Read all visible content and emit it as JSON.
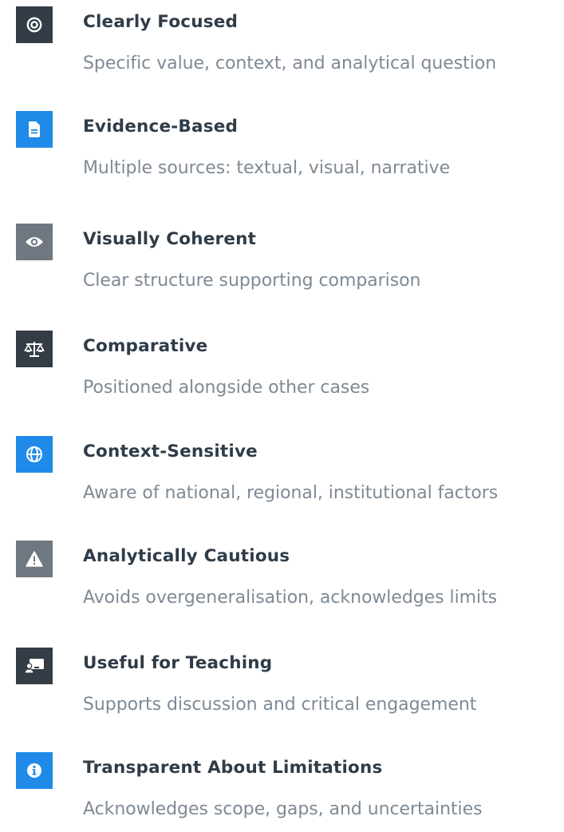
{
  "colors": {
    "dark": "#343d46",
    "blue": "#1f8ae8",
    "gray": "#6f7880",
    "title": "#2f3c48",
    "desc": "#7e8a95"
  },
  "items": [
    {
      "title": "Clearly Focused",
      "desc": "Specific value, context, and analytical question",
      "icon": "target-icon",
      "color": "dark"
    },
    {
      "title": "Evidence-Based",
      "desc": "Multiple sources: textual, visual, narrative",
      "icon": "document-icon",
      "color": "blue"
    },
    {
      "title": "Visually Coherent",
      "desc": "Clear structure supporting comparison",
      "icon": "eye-icon",
      "color": "gray"
    },
    {
      "title": "Comparative",
      "desc": "Positioned alongside other cases",
      "icon": "scale-icon",
      "color": "dark"
    },
    {
      "title": "Context-Sensitive",
      "desc": "Aware of national, regional, institutional factors",
      "icon": "globe-icon",
      "color": "blue"
    },
    {
      "title": "Analytically Cautious",
      "desc": "Avoids overgeneralisation, acknowledges limits",
      "icon": "warning-icon",
      "color": "gray"
    },
    {
      "title": "Useful for Teaching",
      "desc": "Supports discussion and critical engagement",
      "icon": "teacher-icon",
      "color": "dark"
    },
    {
      "title": "Transparent About Limitations",
      "desc": "Acknowledges scope, gaps, and uncertainties",
      "icon": "info-icon",
      "color": "blue"
    }
  ]
}
